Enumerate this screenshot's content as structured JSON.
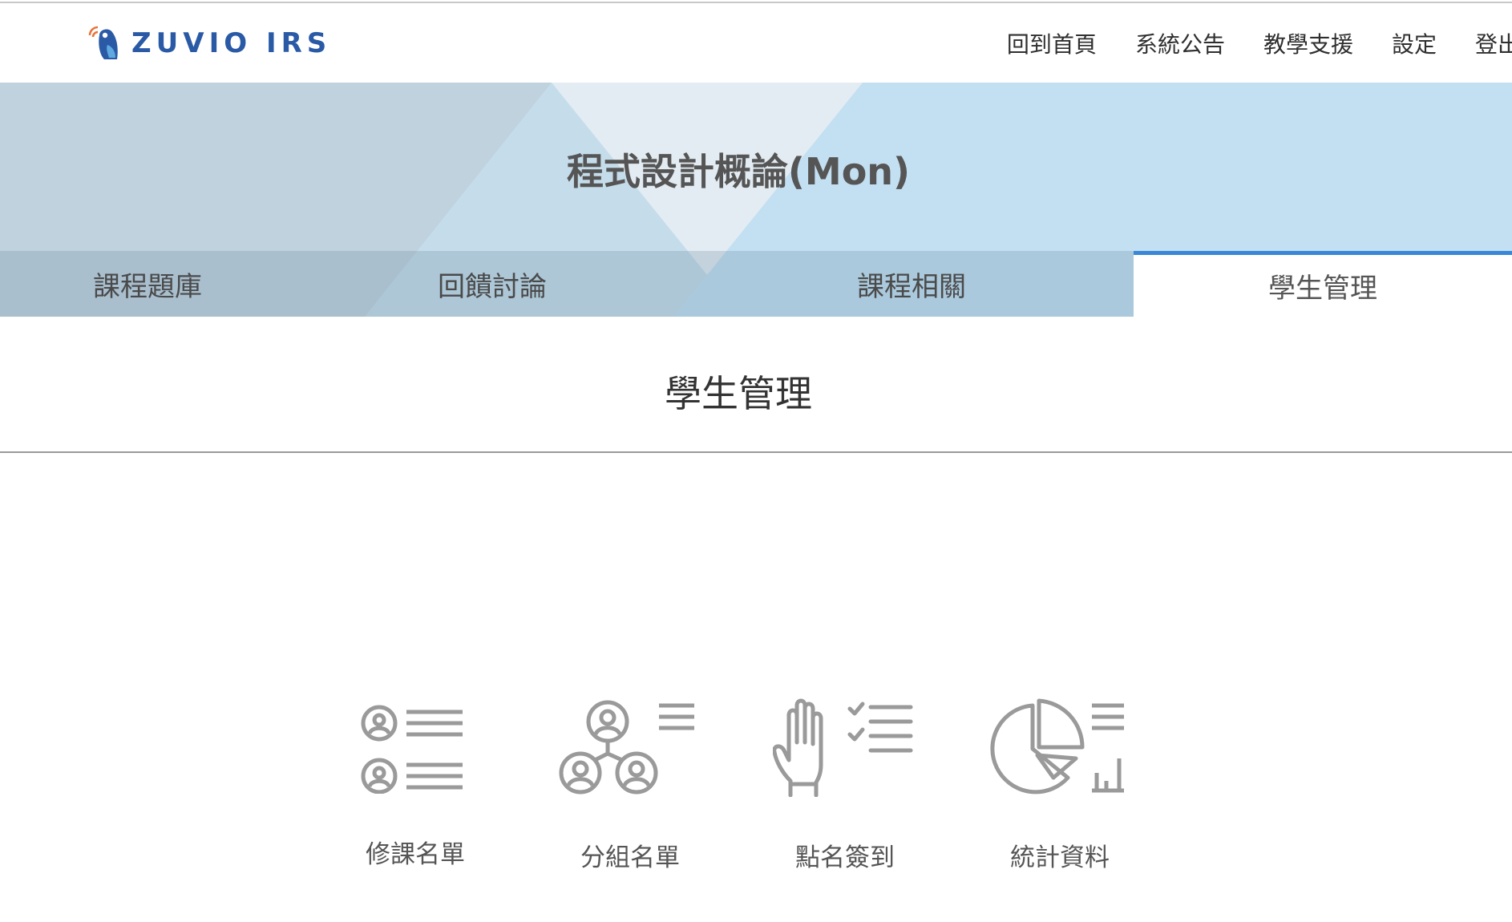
{
  "header": {
    "logo_text": "ZUVIO IRS",
    "nav": [
      {
        "label": "回到首頁"
      },
      {
        "label": "系統公告"
      },
      {
        "label": "教學支援"
      },
      {
        "label": "設定"
      },
      {
        "label": "登出"
      }
    ]
  },
  "course": {
    "title": "程式設計概論(Mon)"
  },
  "tabs": [
    {
      "label": "課程題庫",
      "active": false
    },
    {
      "label": "回饋討論",
      "active": false
    },
    {
      "label": "課程相關",
      "active": false
    },
    {
      "label": "學生管理",
      "active": true
    }
  ],
  "section": {
    "title": "學生管理"
  },
  "features": [
    {
      "label": "修課名單",
      "icon": "roster-list-icon"
    },
    {
      "label": "分組名單",
      "icon": "group-list-icon"
    },
    {
      "label": "點名簽到",
      "icon": "hand-checklist-icon"
    },
    {
      "label": "統計資料",
      "icon": "pie-chart-stats-icon"
    }
  ],
  "colors": {
    "accent_blue": "#3a87d6",
    "logo_blue": "#2a5aa6",
    "logo_orange": "#e8733a",
    "icon_gray": "#9a9a9a"
  }
}
